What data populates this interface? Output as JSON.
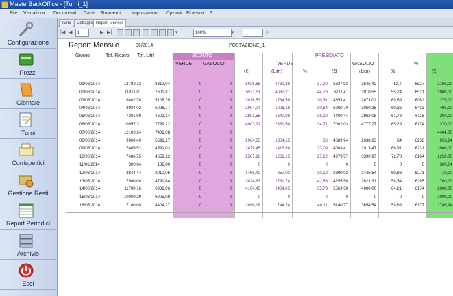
{
  "window": {
    "title": "MasterBackOffice - [Turni_1]"
  },
  "menu": [
    "File",
    "Visualizza",
    "Documenti",
    "Carta",
    "Strumenti",
    "Impostazioni",
    "Opzioni",
    "Finestra",
    "?"
  ],
  "sidebar": [
    {
      "label": "Configurazione",
      "icon": "wrench-icon"
    },
    {
      "label": "Prezzi",
      "icon": "price-tag-icon"
    },
    {
      "label": "Giornale",
      "icon": "journal-icon"
    },
    {
      "label": "Turni",
      "icon": "notepad-icon"
    },
    {
      "label": "Corrispettivi",
      "icon": "register-icon"
    },
    {
      "label": "Gestione Resti",
      "icon": "cash-icon"
    },
    {
      "label": "Report Periodici",
      "icon": "spreadsheet-icon"
    },
    {
      "label": "Archivio",
      "icon": "archive-icon"
    },
    {
      "label": "Esci",
      "icon": "power-icon"
    }
  ],
  "tabs": [
    "Turni",
    "Dettaglio",
    "Report Mensile"
  ],
  "toolbar": {
    "page": "1",
    "zoom": "100%"
  },
  "report": {
    "title": "Report Mensile",
    "period": "06/2014",
    "station": "POSTAZIONE_1",
    "headers": {
      "giorno": "Giorno",
      "tot_ricavo": "Tot. Ricavo",
      "tot_litri": "Tot. Litri",
      "sconto": "SCONTO",
      "presidiato": "PRESIDIATO",
      "verde": "VERDE",
      "gasolio": "GASOLIO",
      "eur": "(€)",
      "litri": "(Litri)",
      "pct": "%"
    },
    "rows": [
      {
        "giorno": "01/06/2014",
        "ricavo": "13782,13",
        "litri": "8812,04",
        "sc_v": "0",
        "sc_g": "0",
        "vv": "8026,65",
        "vl": "4730,36",
        "vp": "37,20",
        "gv": "5637,93",
        "gl": "3645,42",
        "gp": "62,7",
        "x": "6527",
        "e": "2160,00"
      },
      {
        "giorno": "02/06/2014",
        "ricavo": "11811,01",
        "litri": "7601,87",
        "sc_v": "0",
        "sc_g": "0",
        "vv": "5511,51",
        "vl": "4032,21",
        "vp": "44,76",
        "gv": "6211,41",
        "gl": "3910,55",
        "gp": "55,24",
        "x": "6521",
        "e": "1060,00"
      },
      {
        "giorno": "03/06/2014",
        "ricavo": "8402,78",
        "litri": "5106,39",
        "sc_v": "0",
        "sc_g": "0",
        "vv": "3016,53",
        "vl": "1734,59",
        "vp": "30,31",
        "gv": "4653,41",
        "gl": "2673,02",
        "gp": "69,69",
        "x": "6062",
        "e": "275,00"
      },
      {
        "giorno": "04/06/2014",
        "ricavo": "8934,02",
        "litri": "5096,77",
        "sc_v": "0",
        "sc_g": "0",
        "vv": "2004,04",
        "vl": "1006,16",
        "vp": "30,64",
        "gv": "6260,70",
        "gl": "3050,25",
        "gp": "69,36",
        "x": "6433",
        "e": "495,00"
      },
      {
        "giorno": "05/06/2014",
        "ricavo": "7201,99",
        "litri": "4602,14",
        "sc_v": "0",
        "sc_g": "0",
        "vv": "2801,55",
        "vl": "1640,06",
        "vp": "38,22",
        "gv": "4400,44",
        "gl": "2962,08",
        "gp": "61,78",
        "x": "6115",
        "e": "200,00"
      },
      {
        "giorno": "06/06/2014",
        "ricavo": "10957,31",
        "litri": "7789,22",
        "sc_v": "0",
        "sc_g": "0",
        "vv": "4003,22",
        "vl": "2381,50",
        "vp": "34,71",
        "gv": "7002,03",
        "gl": "4777,27",
        "gp": "65,29",
        "x": "6174",
        "e": "370,00"
      },
      {
        "giorno": "07/06/2014",
        "ricavo": "12100,24",
        "litri": "7401,08",
        "sc_v": "0",
        "sc_g": "0",
        "vv": "",
        "vl": "",
        "vp": "",
        "gv": "",
        "gl": "",
        "gp": "",
        "x": "",
        "e": "4404,00"
      },
      {
        "giorno": "08/06/2014",
        "ricavo": "9960,40",
        "litri": "5691,27",
        "sc_v": "0",
        "sc_g": "0",
        "vv": "2964,65",
        "vl": "1354,15",
        "vp": "36",
        "gv": "4689,94",
        "gl": "2638,23",
        "gp": "64",
        "x": "6238",
        "e": "953,94"
      },
      {
        "giorno": "09/06/2014",
        "ricavo": "7465,52",
        "litri": "4591,03",
        "sc_v": "0",
        "sc_g": "0",
        "vv": "2479,45",
        "vl": "1416,98",
        "vp": "33,09",
        "gv": "4003,41",
        "gl": "2913,47",
        "gp": "66,91",
        "x": "6231",
        "e": "1080,00"
      },
      {
        "giorno": "10/06/2014",
        "ricavo": "7486,75",
        "litri": "4652,12",
        "sc_v": "0",
        "sc_g": "0",
        "vv": "2507,18",
        "vl": "1261,15",
        "vp": "27,22",
        "gv": "4979,57",
        "gl": "3390,97",
        "gp": "72,78",
        "x": "6164",
        "e": "1250,00"
      },
      {
        "giorno": "11/06/2014",
        "ricavo": "300,04",
        "litri": "182,00",
        "sc_v": "0",
        "sc_g": "0",
        "vv": "0",
        "vl": "0",
        "vp": "0",
        "gv": "0",
        "gl": "0",
        "gp": "0",
        "x": "0",
        "e": "300,04"
      },
      {
        "giorno": "12/06/2014",
        "ricavo": "3844,44",
        "litri": "2910,06",
        "sc_v": "0",
        "sc_g": "0",
        "vv": "1468,42",
        "vl": "857,03",
        "vp": "30,12",
        "gv": "2390,02",
        "gl": "2445,54",
        "gp": "69,88",
        "x": "6271",
        "e": "10,00"
      },
      {
        "giorno": "13/06/2014",
        "ricavo": "7980,08",
        "litri": "4791,84",
        "sc_v": "0",
        "sc_g": "0",
        "vv": "3024,63",
        "vl": "1731,74",
        "vp": "41,66",
        "gv": "4255,50",
        "gl": "2623,31",
        "gp": "58,34",
        "x": "6295",
        "e": "700,00"
      },
      {
        "giorno": "14/06/2014",
        "ricavo": "11700,16",
        "litri": "6981,06",
        "sc_v": "0",
        "sc_g": "0",
        "vv": "4104,43",
        "vl": "2464,05",
        "vp": "35,79",
        "gv": "5569,50",
        "gl": "4000,00",
        "gp": "64,21",
        "x": "6174",
        "e": "2000,00"
      },
      {
        "giorno": "15/06/2014",
        "ricavo": "10009,29",
        "litri": "6205,09",
        "sc_v": "0",
        "sc_g": "0",
        "vv": "0",
        "vl": "0",
        "vp": "0",
        "gv": "0",
        "gl": "0",
        "gp": "0",
        "x": "0",
        "e": "2009,00"
      },
      {
        "giorno": "16/06/2014",
        "ricavo": "7100,00",
        "litri": "4404,27",
        "sc_v": "0",
        "sc_g": "0",
        "vv": "1096,18",
        "vl": "744,24",
        "vp": "40,11",
        "gv": "5140,77",
        "gl": "3654,54",
        "gp": "59,89",
        "x": "6177",
        "e": "1749,94"
      }
    ]
  },
  "colors": {
    "sconto_bg": "#e0a6de",
    "sconto_header": "#c87fc6",
    "presidiato_text": "#6b2c7e",
    "green_col": "#7fe07a",
    "sidebar_text": "#1a2a55"
  }
}
